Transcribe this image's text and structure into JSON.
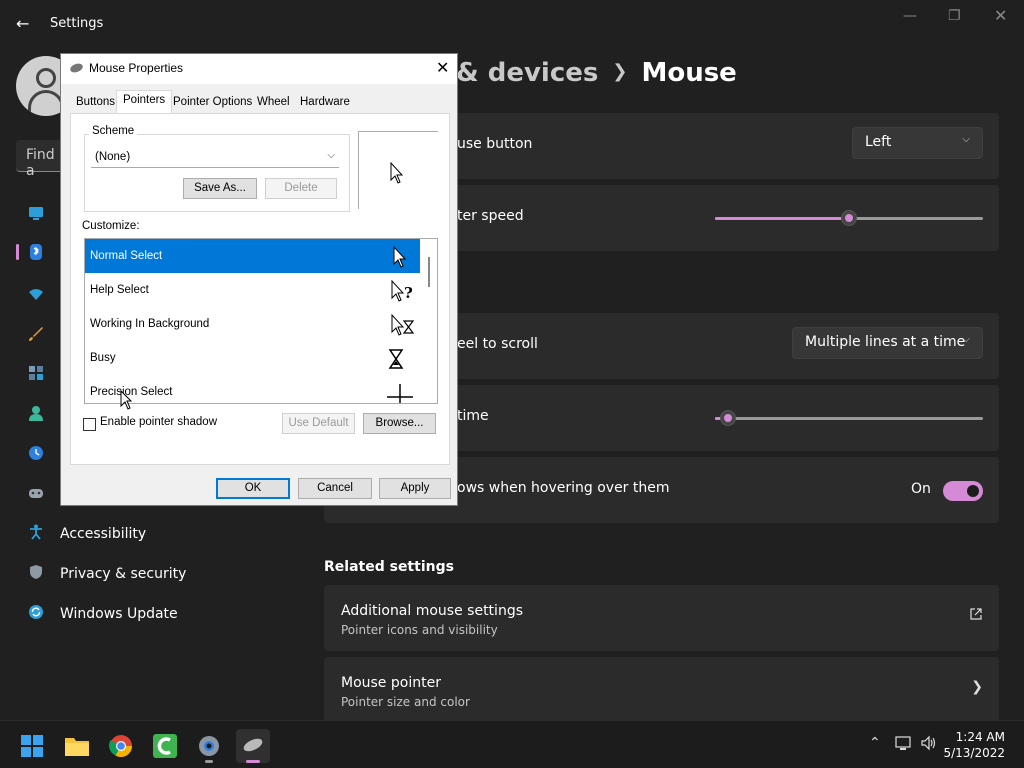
{
  "window": {
    "title": "Settings"
  },
  "search": {
    "placeholder": "Find a"
  },
  "header": {
    "crumb": "& devices",
    "title": "Mouse"
  },
  "sidebar": {
    "items": [
      {
        "label": "Accessibility"
      },
      {
        "label": "Privacy & security"
      },
      {
        "label": "Windows Update"
      }
    ]
  },
  "settings": {
    "primary_button": {
      "label": "use button",
      "value": "Left"
    },
    "pointer_speed": {
      "label": "ter speed",
      "level": 0.5
    },
    "scroll": {
      "label": "eel to scroll",
      "value": "Multiple lines at a time"
    },
    "lines": {
      "label": "time",
      "level": 0.05
    },
    "inactive_scroll": {
      "label": "ows when hovering over them",
      "state": "On"
    }
  },
  "related": {
    "heading": "Related settings",
    "items": [
      {
        "title": "Additional mouse settings",
        "subtitle": "Pointer icons and visibility",
        "icon": "external-link-icon"
      },
      {
        "title": "Mouse pointer",
        "subtitle": "Pointer size and color",
        "icon": "chevron-right-icon"
      }
    ]
  },
  "dialog": {
    "title": "Mouse Properties",
    "tabs": [
      "Buttons",
      "Pointers",
      "Pointer Options",
      "Wheel",
      "Hardware"
    ],
    "active_tab": "Pointers",
    "scheme": {
      "label": "Scheme",
      "value": "(None)",
      "save_as": "Save As...",
      "delete": "Delete"
    },
    "customize_label": "Customize:",
    "cursors": [
      {
        "name": "Normal Select",
        "icon": "arrow-cursor-icon",
        "selected": true
      },
      {
        "name": "Help Select",
        "icon": "help-cursor-icon"
      },
      {
        "name": "Working In Background",
        "icon": "working-cursor-icon"
      },
      {
        "name": "Busy",
        "icon": "hourglass-icon"
      },
      {
        "name": "Precision Select",
        "icon": "crosshair-icon"
      }
    ],
    "shadow_label": "Enable pointer shadow",
    "use_default": "Use Default",
    "browse": "Browse...",
    "ok": "OK",
    "cancel": "Cancel",
    "apply": "Apply"
  },
  "taskbar": {
    "time": "1:24 AM",
    "date": "5/13/2022"
  },
  "colors": {
    "accent": "#d58ad5",
    "selection": "#0078d7",
    "background": "#202020",
    "card": "#2b2b2b"
  }
}
